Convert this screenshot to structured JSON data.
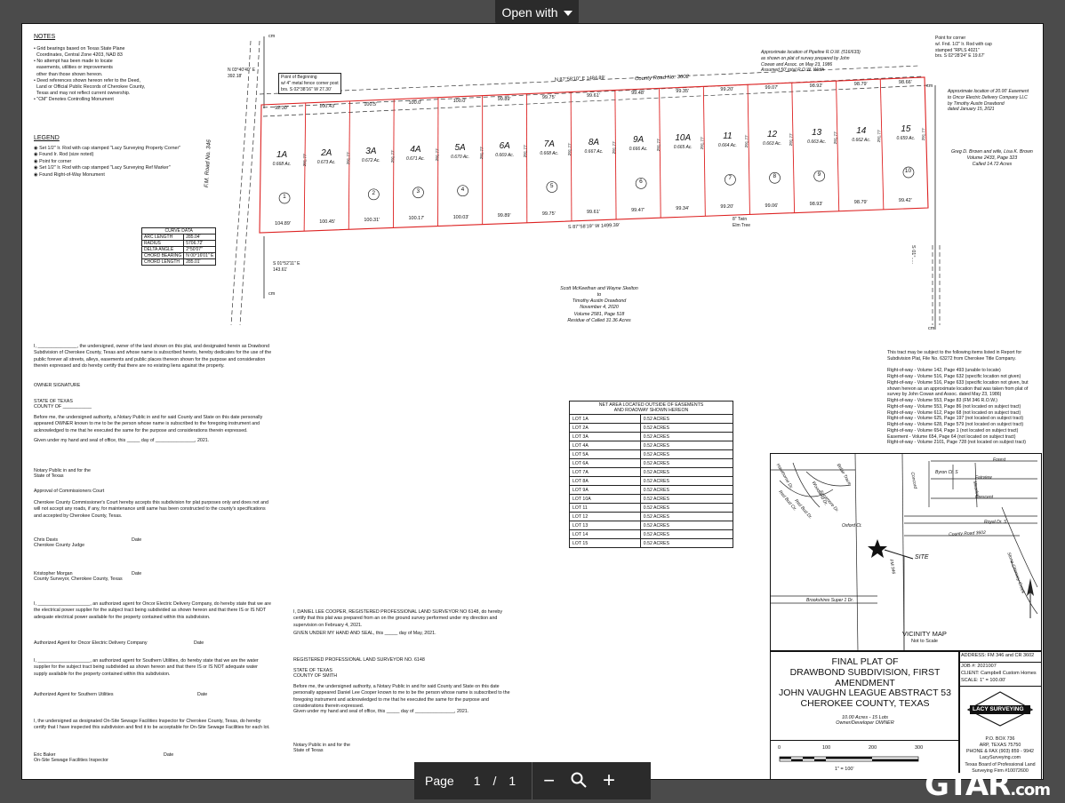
{
  "viewer": {
    "open_with": "Open with",
    "page_label": "Page",
    "page_current": "1",
    "page_sep": "/",
    "page_total": "1",
    "zoom_out": "−",
    "zoom_icon": "magnify-icon",
    "zoom_in": "+",
    "brand": "GTAR",
    "brand_suffix": ".com"
  },
  "notes": {
    "title": "NOTES",
    "items": [
      "• Grid bearings based on Texas State Plane",
      "  Coordinates, Central Zone 4203, NAD 83",
      "• No attempt has been made to locate",
      "  easements, utilities or improvements",
      "  other than those shown hereon.",
      "• Deed references shown hereon refer to the Deed,",
      "  Land or Official Public Records of Cherokee County,",
      "  Texas and may not reflect current ownership.",
      "• \"CM\" Denotes Controlling Monument"
    ]
  },
  "legend": {
    "title": "LEGEND",
    "items": [
      "Set 1/2\" Ir. Rod with cap stamped \"Lacy Surveying Property Corner\"",
      "Found Ir. Rod (size noted)",
      "Point for corner",
      "Set 1/2\" Ir. Rod with cap stamped \"Lacy Surveying Ref Marker\"",
      "Found Right-of-Way Monument"
    ]
  },
  "plat": {
    "road_top": "County Road No. 3602",
    "road_left": "F.M. Road No. 346",
    "pob": [
      "Point of Beginning",
      "w/ 4\" metal fence corner post",
      "brs. S 02°38'16\" W 27.30'"
    ],
    "bearing_top": "N 87°58'10\" E 1484.89'",
    "bearing_bottom": "S 87°58'19\" W 1499.39'",
    "bearing_nw": [
      "N 03°40'40\" E",
      "392.18'"
    ],
    "bearing_sw": [
      "S 01°52'11\" E",
      "143.61'"
    ],
    "cm_label": "cm",
    "twin_elm": [
      "8\" Twin",
      "Elm Tree"
    ],
    "pipeline": [
      "Approximate location of Pipeline R.O.W. (516/633)",
      "as shown on plat of survey prepared by John",
      "Cowan and Assoc. on May 23, 1986",
      "Assumed 50' total R.O.W. Width"
    ],
    "corner_note": [
      "Point for corner",
      "w/. Fnd. 1/2\" Ir. Rod with cap",
      "stamped \"RPLS 4021\"",
      "brs. S 02°28'24\" E 19.67'"
    ],
    "easement": [
      "Approximate location of 20.00' Easement",
      "to Oncor Electric Delivery Company LLC",
      "by Timothy Austin Drawbond",
      "dated January 15, 2021"
    ],
    "east_owner": [
      "Greg D. Brown and wife, Lisa K. Brown",
      "Volume 2433, Page 323",
      "Called 14.72 Acres"
    ],
    "south_owner": [
      "Scott McKeethan and Wayne Skelton",
      "to",
      "Timothy Austin Drawbond",
      "November 4, 2020",
      "Volume 2581, Page 518",
      "Residue of Called 31.36 Acres"
    ],
    "east_bearing": "S 01°.....",
    "lots": [
      {
        "name": "1A",
        "acres": "0.668 Ac.",
        "circle": "1",
        "bottom": "104.89'",
        "top": "92.30'"
      },
      {
        "name": "2A",
        "acres": "0.673 Ac.",
        "circle": "",
        "bottom": "100.45'",
        "top": "100.43'"
      },
      {
        "name": "3A",
        "acres": "0.672 Ac.",
        "circle": "2",
        "bottom": "100.31'",
        "top": "100.5'"
      },
      {
        "name": "4A",
        "acres": "0.671 Ac.",
        "circle": "3",
        "bottom": "100.17'",
        "top": "100.0'"
      },
      {
        "name": "5A",
        "acres": "0.670 Ac.",
        "circle": "4",
        "bottom": "100.03'",
        "top": "100.0'"
      },
      {
        "name": "6A",
        "acres": "0.669 Ac.",
        "circle": "",
        "bottom": "99.89'",
        "top": "99.89'"
      },
      {
        "name": "7A",
        "acres": "0.668 Ac.",
        "circle": "5",
        "bottom": "99.75'",
        "top": "99.75'"
      },
      {
        "name": "8A",
        "acres": "0.667 Ac.",
        "circle": "",
        "bottom": "99.61'",
        "top": "99.61'"
      },
      {
        "name": "9A",
        "acres": "0.666 Ac.",
        "circle": "6",
        "bottom": "99.47'",
        "top": "99.48'"
      },
      {
        "name": "10A",
        "acres": "0.665 Ac.",
        "circle": "",
        "bottom": "99.34'",
        "top": "99.35'"
      },
      {
        "name": "11",
        "acres": "0.664 Ac.",
        "circle": "7",
        "bottom": "99.20'",
        "top": "99.20'"
      },
      {
        "name": "12",
        "acres": "0.663 Ac.",
        "circle": "8",
        "bottom": "99.06'",
        "top": "99.07'"
      },
      {
        "name": "13",
        "acres": "0.663 Ac.",
        "circle": "9",
        "bottom": "98.93'",
        "top": "98.92'"
      },
      {
        "name": "14",
        "acres": "0.662 Ac.",
        "circle": "",
        "bottom": "98.79'",
        "top": "98.79'"
      },
      {
        "name": "15",
        "acres": "0.659 Ac.",
        "circle": "10",
        "bottom": "99.42'",
        "top": "98.66'"
      }
    ],
    "lot_side": "291.77'"
  },
  "curve": {
    "title": "CURVE DATA",
    "rows": [
      [
        "ARC LENGTH",
        "285.04'"
      ],
      [
        "RADIUS",
        "5706.72'"
      ],
      [
        "DELTA ANGLE",
        "2°50'07\""
      ],
      [
        "CHORD BEARING",
        "N 00°16'01\" E"
      ],
      [
        "CHORD LENGTH",
        "285.01'"
      ]
    ]
  },
  "net_area": {
    "title1": "NET AREA LOCATED OUTSIDE OF EASEMENTS",
    "title2": "AND ROADWAY SHOWN HEREON",
    "rows": [
      [
        "LOT 1A",
        "0.52 ACRES"
      ],
      [
        "LOT 2A",
        "0.52 ACRES"
      ],
      [
        "LOT 3A",
        "0.52 ACRES"
      ],
      [
        "LOT 4A",
        "0.52 ACRES"
      ],
      [
        "LOT 5A",
        "0.52 ACRES"
      ],
      [
        "LOT 6A",
        "0.52 ACRES"
      ],
      [
        "LOT 7A",
        "0.52 ACRES"
      ],
      [
        "LOT 8A",
        "0.52 ACRES"
      ],
      [
        "LOT 9A",
        "0.52 ACRES"
      ],
      [
        "LOT 10A",
        "0.52 ACRES"
      ],
      [
        "LOT 11",
        "0.52 ACRES"
      ],
      [
        "LOT 12",
        "0.52 ACRES"
      ],
      [
        "LOT 13",
        "0.52 ACRES"
      ],
      [
        "LOT 14",
        "0.52 ACRES"
      ],
      [
        "LOT 15",
        "0.52 ACRES"
      ]
    ]
  },
  "subject": {
    "intro": "This tract may be subject to the following items listed in Report for Subdivision Plat, File No. 63272 from Cherokee Title Company.",
    "items": [
      "Right-of-way - Volume 142, Page 493 (unable to locate)",
      "Right-of-way - Volume 516, Page 632 (specific location not given)",
      "Right-of-way - Volume 516, Page 633 (specific location not given, but shown hereon as an approximate location that was taken from plat of survey by John Cowan and Assoc. dated May 23, 1986)",
      "Right-of-way - Volume 553, Page 83 (FM 346 R.O.W.)",
      "Right-of-way - Volume 553, Page 86 (not located on subject tract)",
      "Right-of-way - Volume 612, Page 68 (not located on subject tract)",
      "Right-of-way - Volume 625, Page 197 (not located on subject tract)",
      "Right-of-way - Volume 628, Page 579 (not located on subject tract)",
      "Right-of-way - Volume 654, Page 1 (not located on subject tract)",
      "Easement - Volume 654, Page 64 (not located on subject tract)",
      "Right-of-way - Volume 2101, Page 728 (not located on subject tract)"
    ]
  },
  "owner_cert": {
    "dedication": "I, _______________, the undersigned, owner of the land shown on this plat, and designated herein as Drawbond Subdivision of Cherokee County, Texas and whose name is subscribed hereto, hereby dedicates for the use of the public forever all streets, alleys, easements and public places thereon shown for the purpose and consideration therein expressed and do hereby certify that there are no existing liens against the property.",
    "owner_sig": "OWNER SIGNATURE",
    "state": "STATE OF TEXAS",
    "county": "COUNTY OF ___________",
    "notary": "Before me, the undersigned authority, a Notary Public in and for said County and State on this date personally appeared OWNER known to me to be the person whose name is subscribed to the foregoing instrument and acknowledged to me that he executed the same for the purpose and considerations therein expressed.",
    "given": "Given under my hand and seal of office, this _____ day of _______________, 2021.",
    "notary_sig": [
      "Notary Public in and for the",
      "State of Texas"
    ],
    "approval_title": "Approval of Commissioners Court",
    "approval": "Cherokee County Commissioner's Court hereby accepts this subdivision for plat purposes only and does not and will not accept any roads, if any, for maintenance until same has been constructed to the county's specifications and accepted by Cherokee County, Texas.",
    "judge": [
      "Chris Davis",
      "Cherokee County Judge"
    ],
    "date": "Date",
    "surveyor": [
      "Kristopher Morgan",
      "County Surveyor, Cherokee County, Texas"
    ],
    "oncor": "I, ____________________, an authorized agent for Oncor Electric Delivery Company, do hereby state that we are the electrical power supplier for the subject tract being subdivided as shown hereon and that there IS or IS NOT adequate electrical power available for the property contained within this subdivision.",
    "oncor_sig": "Authorized Agent for Oncor Electric Delivery Company",
    "water": "I, ____________________, an authorized agent for Southern Utilities, do hereby state that we are the water supplier for the subject tract being subdivided as shown hereon and that there IS or IS NOT adequate water supply available for the property contained within this subdivision.",
    "water_sig": "Authorized Agent for Southern Utilities",
    "septic": "I, the undersigned as designated On-Site Sewage Facilities Inspector for Cherokee County, Texas, do hereby certify that I have inspected this subdivision and find it to be acceptable for On-Site Sewage Facilities for each lot.",
    "inspector": [
      "Eric Baker",
      "On-Site Sewage Facilities Inspector"
    ]
  },
  "surveyor_cert": {
    "text": "I, DANIEL LEE COOPER, REGISTERED PROFESSIONAL LAND SURVEYOR NO 6148, do hereby certify that this plat was prepared from an on the ground survey performed under my direction and supervision on February 4, 2021.",
    "given": "GIVEN UNDER MY HAND AND SEAL, this _____ day of May, 2021.",
    "rpls": "REGISTERED PROFESSIONAL LAND SURVEYOR NO. 6148",
    "state": "STATE OF TEXAS",
    "county": "COUNTY OF SMITH",
    "notary": "Before me, the undersigned authority, a Notary Public in and for said County and State on this date personally appeared Daniel Lee Cooper known to me to be the person whose name is subscribed to the foregoing instrument and acknowledged to me that he executed the same for the purpose and considerations therein expressed.",
    "given2": "Given under my hand and seal of office, this _____ day of _______________, 2021.",
    "notary_sig": [
      "Notary Public in and for the",
      "State of Texas"
    ]
  },
  "vicinity": {
    "title": "VICINITY MAP",
    "subtitle": "Not to Scale",
    "site": "SITE",
    "streets": [
      "Forest",
      "Fairview",
      "Crescent",
      "Royal Dr. S",
      "Oxford Ct.",
      "County Road 3602",
      "Brookshires Super 1 Dr.",
      "FM 346",
      "Byron Ct. S",
      "Meadow",
      "Red Bud Cir.",
      "Hawthorne Dr.",
      "Woodland Dr.",
      "Belair Trace",
      "Sycamore Dr.",
      "Red Bud Dr.",
      "Concord",
      "Stone Chimney Creek"
    ]
  },
  "title_block": {
    "line1": "FINAL PLAT OF",
    "line2": "DRAWBOND SUBDIVISION, FIRST",
    "line3": "AMENDMENT",
    "line4": "JOHN VAUGHN LEAGUE ABSTRACT 53",
    "line5": "CHEROKEE COUNTY, TEXAS",
    "sub1": "10.00 Acres - 15 Lots",
    "sub2": "Owner/Developer OWNER",
    "scale_ticks": [
      "0",
      "100",
      "200",
      "300"
    ],
    "scale_text": "1\" = 100'"
  },
  "info": {
    "address": "ADDRESS: FM 346 and CR 3602",
    "job": "JOB #: 2021007",
    "client": "CLIENT: Campbell Custom Homes",
    "scale": "SCALE: 1\" = 100.00'",
    "logo": "LACY SURVEYING",
    "lines": [
      "P.O. BOX 736",
      "ARP, TEXAS 75750",
      "PHONE & FAX (903) 859 - 9942",
      "LacySurveying.com",
      "Texas Board of Professional Land",
      "Surveying Firm #10072600"
    ]
  }
}
